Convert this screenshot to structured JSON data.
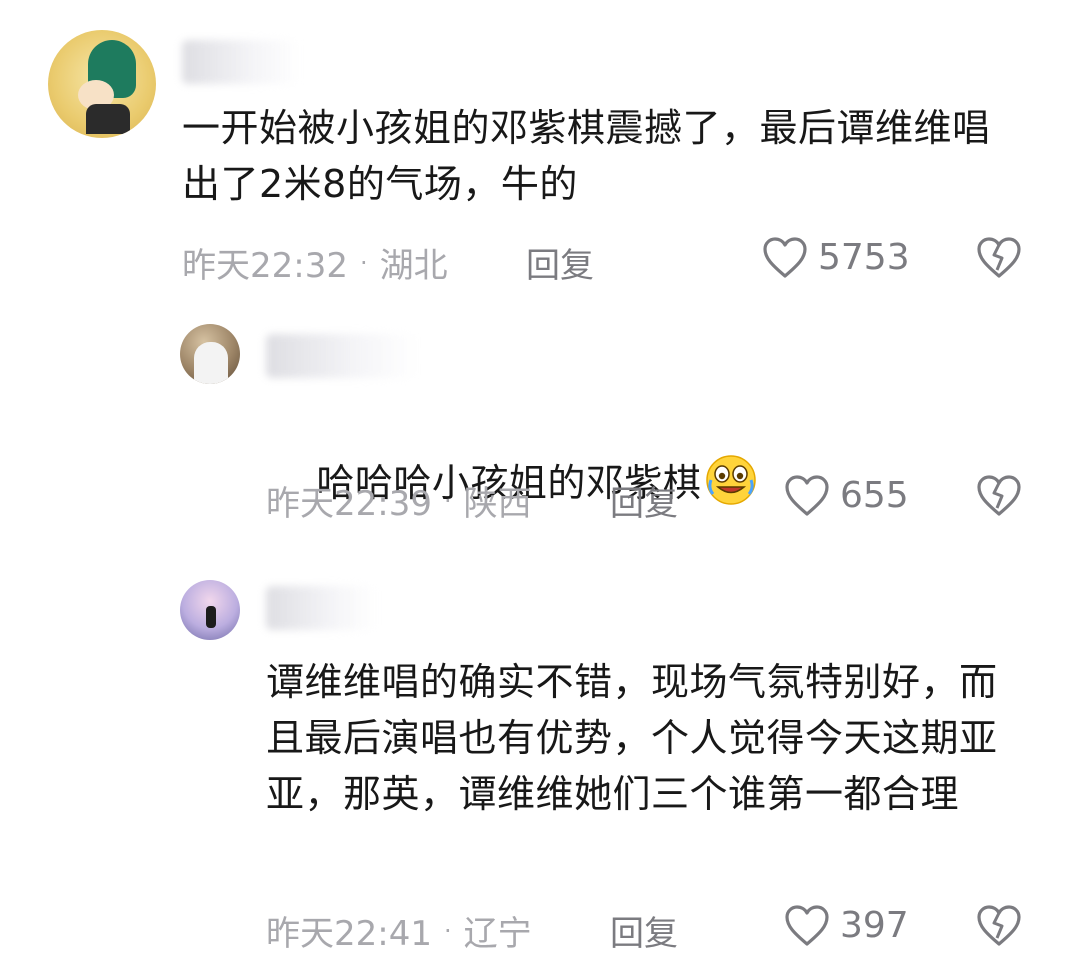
{
  "comments": [
    {
      "text": "一开始被小孩姐的邓紫棋震撼了，最后谭维维唱出了2米8的气场，牛的",
      "time": "昨天22:32",
      "location": "湖北",
      "reply_label": "回复",
      "likes": "5753",
      "avatar_icon": "cartoon-avatar-icon"
    },
    {
      "text": "哈哈哈小孩姐的邓紫棋",
      "emoji": "laughing-crying-emoji-icon",
      "time": "昨天22:39",
      "location": "陕西",
      "reply_label": "回复",
      "likes": "655",
      "avatar_icon": "photo-avatar-icon"
    },
    {
      "text": "谭维维唱的确实不错，现场气氛特别好，而且最后演唱也有优势，个人觉得今天这期亚亚，那英，谭维维她们三个谁第一都合理",
      "time": "昨天22:41",
      "location": "辽宁",
      "reply_label": "回复",
      "likes": "397",
      "avatar_icon": "purple-avatar-icon"
    }
  ],
  "colors": {
    "text": "#181818",
    "meta": "#a8a8ad",
    "action": "#7b7b80"
  }
}
